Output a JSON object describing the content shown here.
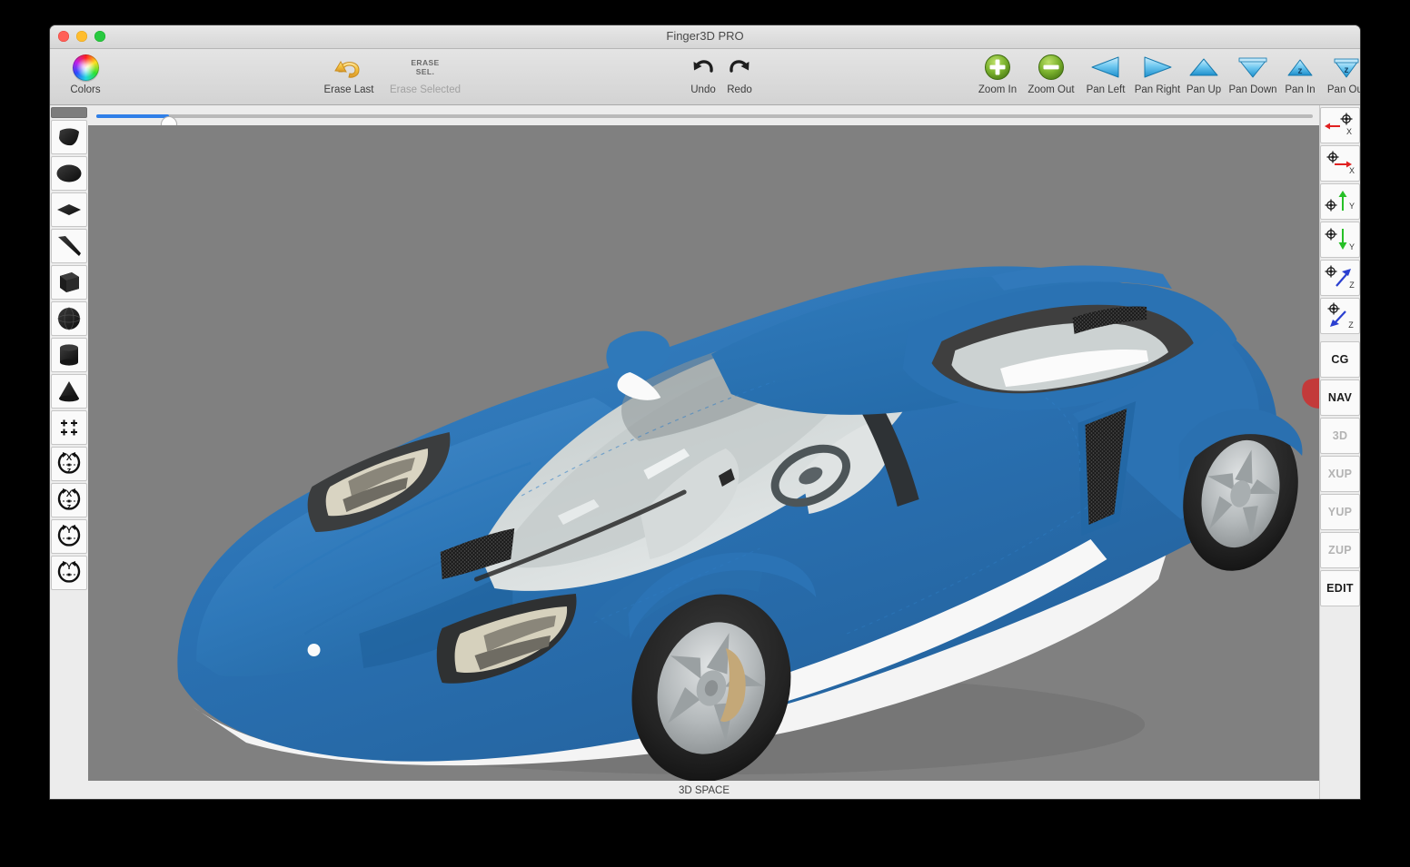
{
  "window": {
    "title": "Finger3D PRO",
    "traffic_lights": [
      "close",
      "minimize",
      "zoom"
    ]
  },
  "toolbar": {
    "colors_label": "Colors",
    "erase_last_label": "Erase Last",
    "erase_selected_label": "Erase Selected",
    "erase_selected_glyph_line1": "ERASE",
    "erase_selected_glyph_line2": "SEL.",
    "undo_label": "Undo",
    "redo_label": "Redo",
    "view_buttons": [
      {
        "label": "Zoom In",
        "icon": "plus-circle-icon"
      },
      {
        "label": "Zoom Out",
        "icon": "minus-circle-icon"
      },
      {
        "label": "Pan Left",
        "icon": "triangle-left-icon"
      },
      {
        "label": "Pan Right",
        "icon": "triangle-right-icon"
      },
      {
        "label": "Pan Up",
        "icon": "triangle-up-icon"
      },
      {
        "label": "Pan Down",
        "icon": "triangle-down-icon"
      },
      {
        "label": "Pan In",
        "icon": "triangle-up-z-icon"
      },
      {
        "label": "Pan Out",
        "icon": "triangle-down-z-icon"
      }
    ]
  },
  "left_tools": [
    {
      "name": "selected-indicator",
      "icon": "selection-bar-icon",
      "selected": true
    },
    {
      "name": "plane-tool",
      "icon": "plane-shape-icon"
    },
    {
      "name": "ellipse-tool",
      "icon": "ellipse-shape-icon"
    },
    {
      "name": "diamond-tool",
      "icon": "diamond-shape-icon"
    },
    {
      "name": "slab-tool",
      "icon": "slab-shape-icon"
    },
    {
      "name": "cube-tool",
      "icon": "cube-shape-icon"
    },
    {
      "name": "sphere-tool",
      "icon": "sphere-shape-icon"
    },
    {
      "name": "cylinder-tool",
      "icon": "cylinder-shape-icon"
    },
    {
      "name": "cone-tool",
      "icon": "cone-shape-icon"
    },
    {
      "name": "duplicate-tool",
      "icon": "four-plus-icon"
    },
    {
      "name": "rotate-xz-ccw-tool",
      "icon": "rotate-xz-ccw-icon",
      "axis_top": "X",
      "axis_mid": "Z"
    },
    {
      "name": "rotate-xz-cw-tool",
      "icon": "rotate-xz-cw-icon",
      "axis_top": "X",
      "axis_mid": "Z"
    },
    {
      "name": "rotate-y-ccw-tool",
      "icon": "rotate-y-ccw-icon",
      "axis_top": "Y"
    },
    {
      "name": "rotate-y-cw-tool",
      "icon": "rotate-y-cw-icon",
      "axis_top": "Y"
    }
  ],
  "right_axis_tools": [
    {
      "name": "move-minus-x",
      "axis": "X",
      "direction": "left",
      "color": "#e02020"
    },
    {
      "name": "move-plus-x",
      "axis": "X",
      "direction": "right",
      "color": "#e02020"
    },
    {
      "name": "move-plus-y",
      "axis": "Y",
      "direction": "up",
      "color": "#27c027"
    },
    {
      "name": "move-minus-y",
      "axis": "Y",
      "direction": "down",
      "color": "#27c027"
    },
    {
      "name": "move-plus-z",
      "axis": "Z",
      "direction": "upright",
      "color": "#2a3fd0"
    },
    {
      "name": "move-minus-z",
      "axis": "Z",
      "direction": "downleft",
      "color": "#2a3fd0"
    }
  ],
  "right_mode_buttons": [
    {
      "label": "CG",
      "enabled": true
    },
    {
      "label": "NAV",
      "enabled": true
    },
    {
      "label": "3D",
      "enabled": false
    },
    {
      "label": "XUP",
      "enabled": false
    },
    {
      "label": "YUP",
      "enabled": false
    },
    {
      "label": "ZUP",
      "enabled": false
    },
    {
      "label": "EDIT",
      "enabled": true
    }
  ],
  "slider": {
    "name": "brush-size-slider",
    "value_percent": 6,
    "fill_color": "#2f7fe8"
  },
  "status": {
    "label": "3D SPACE"
  },
  "canvas": {
    "background_color": "#808080",
    "model_name": "sports-car-3d-model",
    "body_color": "#2b73b5",
    "body_color_dark": "#1d5c96",
    "body_color_light": "#4a90cf",
    "rocker_color": "#f2f2f2",
    "glass_color": "#d9dede",
    "tire_color": "#232323",
    "rim_color": "#b9bdbf",
    "caliper_color": "#c4a878",
    "taillight_color": "#c33a3a"
  }
}
